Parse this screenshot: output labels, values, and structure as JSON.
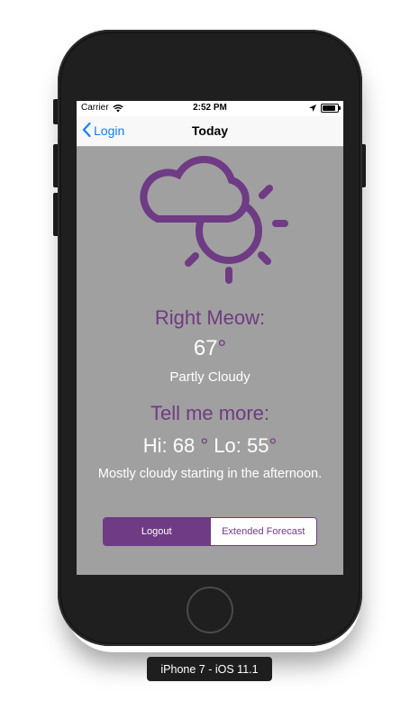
{
  "simulator": {
    "device_label": "iPhone 7 - iOS 11.1"
  },
  "status_bar": {
    "carrier": "Carrier",
    "time": "2:52 PM",
    "icons": [
      "wifi-icon",
      "location-arrow-icon",
      "battery-icon"
    ],
    "battery_level": 0.85
  },
  "nav_bar": {
    "back_label": "Login",
    "title": "Today"
  },
  "weather": {
    "icon": "partly-cloudy-icon",
    "now_heading": "Right Meow:",
    "current_temp_value": "67",
    "degree_symbol": "°",
    "condition": "Partly Cloudy",
    "more_heading": "Tell me more:",
    "hi_label": "Hi: 68",
    "lo_label": "Lo: 55",
    "summary": "Mostly cloudy starting in the afternoon."
  },
  "segmented_control": {
    "selected_index": 0,
    "segments": [
      "Logout",
      "Extended Forecast"
    ]
  },
  "colors": {
    "accent": "#6f3b84",
    "screen_background": "#a0a0a0",
    "ios_blue": "#147efb"
  }
}
